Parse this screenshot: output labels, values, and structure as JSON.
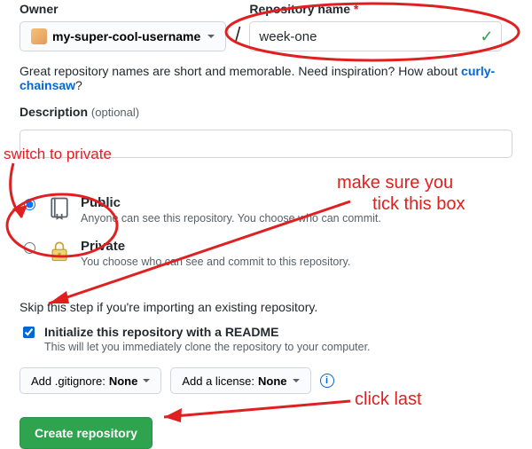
{
  "labels": {
    "owner": "Owner",
    "repo": "Repository name",
    "required": "*",
    "desc": "Description",
    "optional": "(optional)"
  },
  "owner": {
    "username": "my-super-cool-username"
  },
  "slash": "/",
  "repo": {
    "value": "week-one"
  },
  "hint": {
    "prefix": "Great repository names are short and memorable. Need inspiration? How about ",
    "suggestion": "curly-chainsaw",
    "suffix": "?"
  },
  "visibility": {
    "public": {
      "title": "Public",
      "desc": "Anyone can see this repository. You choose who can commit.",
      "selected": true
    },
    "private": {
      "title": "Private",
      "desc": "You choose who can see and commit to this repository.",
      "selected": false
    }
  },
  "skip": "Skip this step if you're importing an existing repository.",
  "readme": {
    "checked": true,
    "title": "Initialize this repository with a README",
    "desc": "This will let you immediately clone the repository to your computer."
  },
  "dropdowns": {
    "gitignore": {
      "prefix": "Add .gitignore: ",
      "value": "None"
    },
    "license": {
      "prefix": "Add a license: ",
      "value": "None"
    }
  },
  "buttons": {
    "create": "Create repository"
  },
  "annotations": {
    "switch": "switch to private",
    "tick1": "make sure you",
    "tick2": "tick this box",
    "last": "click last"
  },
  "colors": {
    "annotation": "#e02020",
    "primary_btn": "#2ea44f",
    "link": "#0366d6"
  }
}
